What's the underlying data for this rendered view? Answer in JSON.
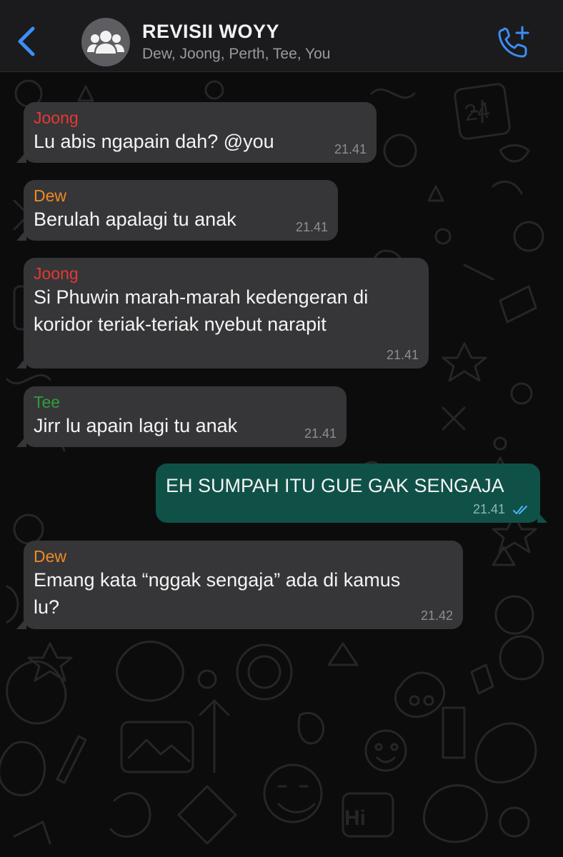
{
  "header": {
    "title": "REVISII WOYY",
    "members": "Dew, Joong, Perth, Tee, You",
    "back_icon": "chevron-left-icon",
    "avatar_icon": "group-icon",
    "call_icon": "add-call-icon",
    "accent_color": "#3a8ff7"
  },
  "messages": [
    {
      "sender": "Joong",
      "sender_color": "#e53935",
      "text": "Lu abis ngapain dah? @you",
      "time": "21.41"
    },
    {
      "sender": "Dew",
      "sender_color": "#f08a24",
      "text": "Berulah apalagi tu anak",
      "time": "21.41"
    },
    {
      "sender": "Joong",
      "sender_color": "#e53935",
      "text_line1": "Si Phuwin marah-marah kedengeran di",
      "text_line2": "koridor teriak-teriak nyebut narapit",
      "time": "21.41"
    },
    {
      "sender": "Tee",
      "sender_color": "#2e9e3a",
      "text": "Jirr lu apain lagi tu anak",
      "time": "21.41"
    },
    {
      "outgoing": true,
      "text": "EH SUMPAH ITU GUE GAK SENGAJA",
      "time": "21.41",
      "status_icon": "double-check-icon"
    },
    {
      "sender": "Dew",
      "sender_color": "#f08a24",
      "text_line1": "Emang kata “nggak sengaja” ada di kamus",
      "text_line2": "lu?",
      "time": "21.42"
    }
  ],
  "wallpaper": {
    "stamp_text": "Hi",
    "calendar_text": "24"
  },
  "colors": {
    "incoming_bubble": "#363638",
    "outgoing_bubble": "#0f5147",
    "background": "#0c0c0c"
  }
}
